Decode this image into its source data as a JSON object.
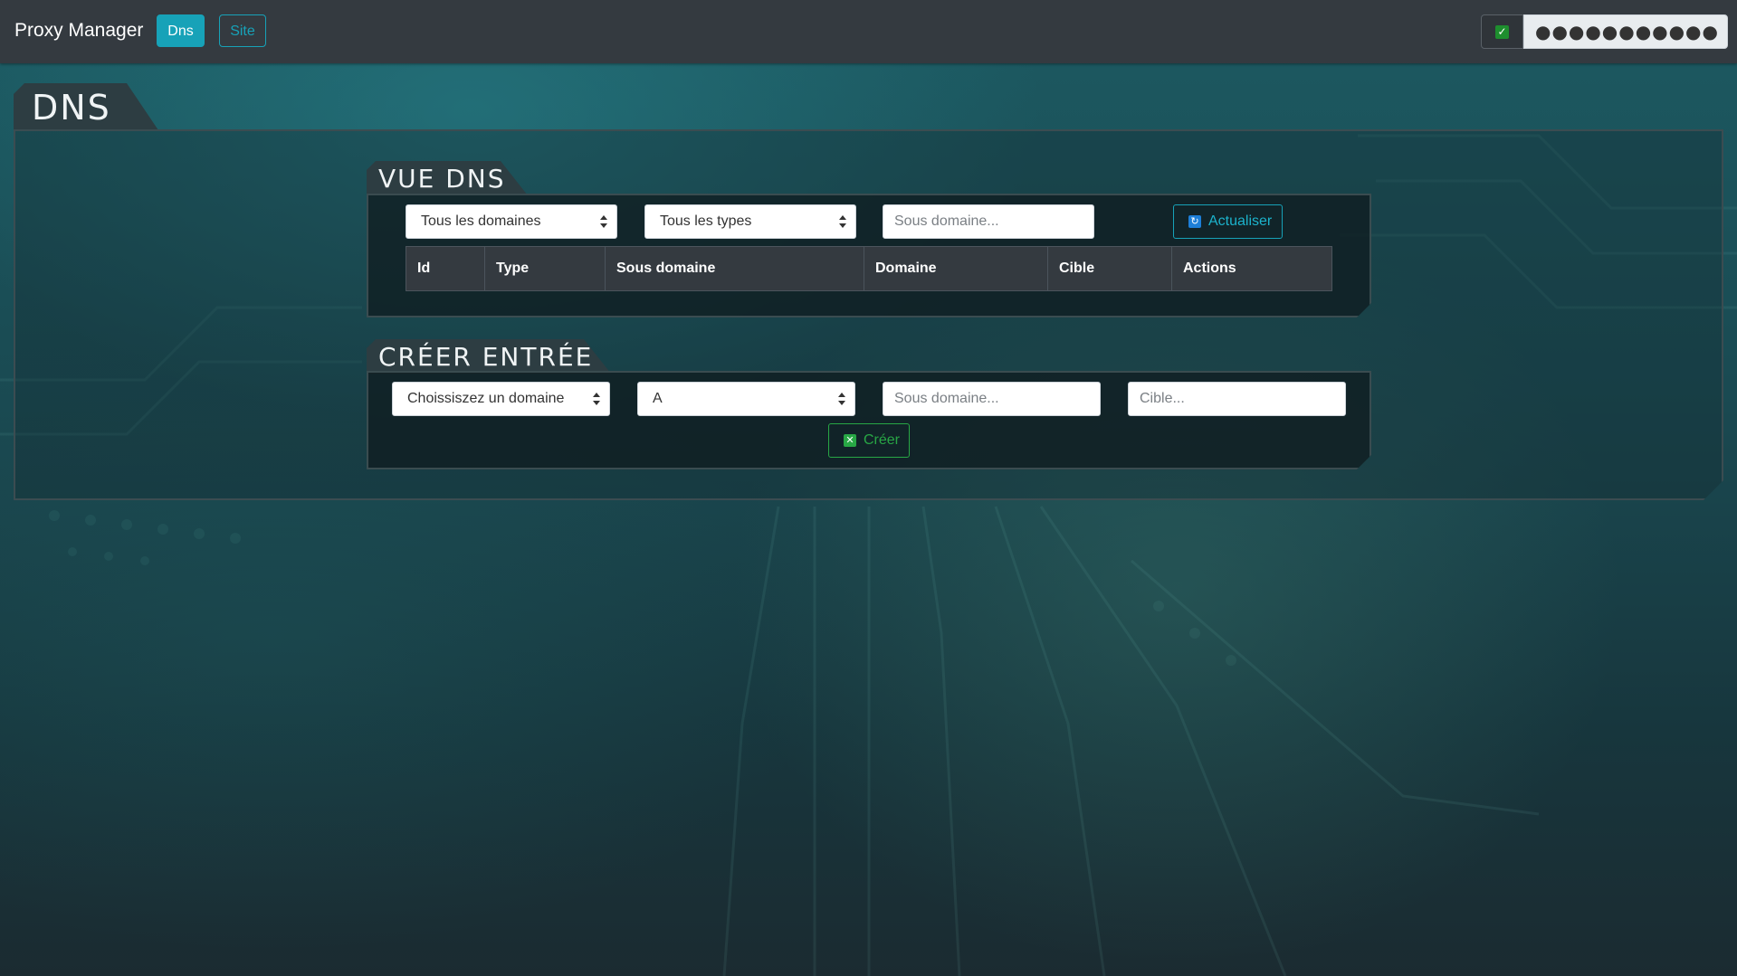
{
  "navbar": {
    "brand": "Proxy Manager",
    "nav_items": [
      {
        "label": "Dns",
        "active": true
      },
      {
        "label": "Site",
        "active": false
      }
    ],
    "auth": {
      "checked": true,
      "password_value": "●●●●●●●●●●●"
    }
  },
  "page": {
    "title": "DNS"
  },
  "view_dns": {
    "title": "VUE DNS",
    "domain_filter": "Tous les domaines",
    "type_filter": "Tous les types",
    "subdomain_placeholder": "Sous domaine...",
    "refresh_label": "Actualiser",
    "table": {
      "columns": [
        "Id",
        "Type",
        "Sous domaine",
        "Domaine",
        "Cible",
        "Actions"
      ],
      "rows": []
    }
  },
  "create_entry": {
    "title": "CRÉER ENTRÉE",
    "domain_select": "Choissiszez un domaine",
    "type_select": "A",
    "subdomain_placeholder": "Sous domaine...",
    "target_placeholder": "Cible...",
    "create_label": "Créer"
  },
  "colors": {
    "navbar_bg": "#343a40",
    "accent_info": "#17a2b8",
    "accent_success": "#28a745",
    "panel_tab_bg": "#2d3d42"
  }
}
